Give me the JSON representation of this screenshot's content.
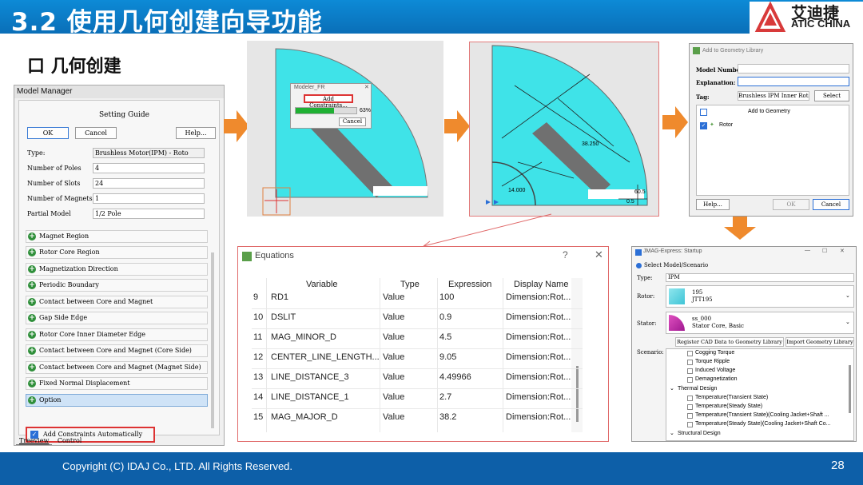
{
  "header": {
    "title": "3.2 使用几何创建向导功能",
    "logo_cn": "艾迪捷",
    "logo_en": "ATIC CHINA"
  },
  "section_title": "口 几何创建",
  "model_manager": {
    "title": "Model Manager",
    "setting_guide": "Setting Guide",
    "ok": "OK",
    "cancel": "Cancel",
    "help": "Help...",
    "fields": [
      {
        "label": "Type:",
        "value": "Brushless Motor(IPM) - Roto"
      },
      {
        "label": "Number of Poles",
        "value": "4"
      },
      {
        "label": "Number of Slots",
        "value": "24"
      },
      {
        "label": "Number of Magnets",
        "value": "1"
      },
      {
        "label": "Partial Model",
        "value": "1/2 Pole"
      }
    ],
    "tree": [
      "Magnet Region",
      "Rotor Core Region",
      "Magnetization Direction",
      "Periodic Boundary",
      "Contact between Core and Magnet",
      "Gap Side Edge",
      "Rotor Core Inner Diameter Edge",
      "Contact between Core and Magnet (Core Side)",
      "Contact between Core and Magnet (Magnet Side)",
      "Fixed Normal Displacement",
      "Option"
    ],
    "checkbox_label": "Add Constraints Automatically",
    "tabs": [
      "Treeview",
      "Control"
    ]
  },
  "modeler": {
    "title": "Modeler_FR",
    "button": "Add Constraints...",
    "progress_value": 0.63,
    "progress_text": "63%",
    "cancel": "Cancel"
  },
  "dims": {
    "d1": "38.250",
    "d2": "14.000",
    "d3": "60.5",
    "d4": "0.5"
  },
  "geometry_library": {
    "title": "Add to Geometry Library",
    "model_number_label": "Model Number:",
    "explanation_label": "Explanation:",
    "tag_label": "Tag:",
    "tag_value": "Brushless IPM Inner Rotor",
    "select": "Select",
    "add_to_geometry": "Add to Geometry",
    "rotor": "Rotor",
    "help": "Help...",
    "ok": "OK",
    "cancel": "Cancel"
  },
  "equations": {
    "title": "Equations",
    "help": "?",
    "headers": [
      "Variable",
      "Type",
      "Expression",
      "Display Name"
    ],
    "rows": [
      [
        "9",
        "RD1",
        "Value",
        "100",
        "Dimension:Rot..."
      ],
      [
        "10",
        "DSLIT",
        "Value",
        "0.9",
        "Dimension:Rot..."
      ],
      [
        "11",
        "MAG_MINOR_D",
        "Value",
        "4.5",
        "Dimension:Rot..."
      ],
      [
        "12",
        "CENTER_LINE_LENGTH...",
        "Value",
        "9.05",
        "Dimension:Rot..."
      ],
      [
        "13",
        "LINE_DISTANCE_3",
        "Value",
        "4.49966",
        "Dimension:Rot..."
      ],
      [
        "14",
        "LINE_DISTANCE_1",
        "Value",
        "2.7",
        "Dimension:Rot..."
      ],
      [
        "15",
        "MAG_MAJOR_D",
        "Value",
        "38.2",
        "Dimension:Rot..."
      ]
    ]
  },
  "startup": {
    "title": "JMAG-Express: Startup",
    "select_label": "Select Model/Scenario",
    "type_label": "Type:",
    "type_value": "IPM",
    "rotor_label": "Rotor:",
    "rotor_l1": "195",
    "rotor_l2": "JTT195",
    "stator_label": "Stator:",
    "stator_l1": "ss_000",
    "stator_l2": "Stator Core, Basic",
    "register_btn": "Register CAD Data to Geometry Library",
    "import_btn": "Import Geometry Library",
    "scenario_label": "Scenario:",
    "scenarios": [
      "Cogging Torque",
      "Torque Ripple",
      "Induced Voltage",
      "Demagnetization"
    ],
    "thermal_group": "Thermal Design",
    "thermal": [
      "Temperature(Transient State)",
      "Temperature(Steady State)",
      "Temperature(Transient State)(Cooling Jacket+Shaft ...",
      "Temperature(Steady State)(Cooling Jacket+Shaft Co..."
    ],
    "structural_group": "Structural Design"
  },
  "footer": {
    "copyright": "Copyright (C) IDAJ Co., LTD. All Rights Reserved.",
    "page": "28"
  },
  "colors": {
    "header_blue": "#0a7fcb",
    "footer_blue": "#0d5fa8",
    "arrow_orange": "#ef8a2d",
    "highlight_red": "#d33333",
    "model_cyan": "#3fe3e8"
  }
}
